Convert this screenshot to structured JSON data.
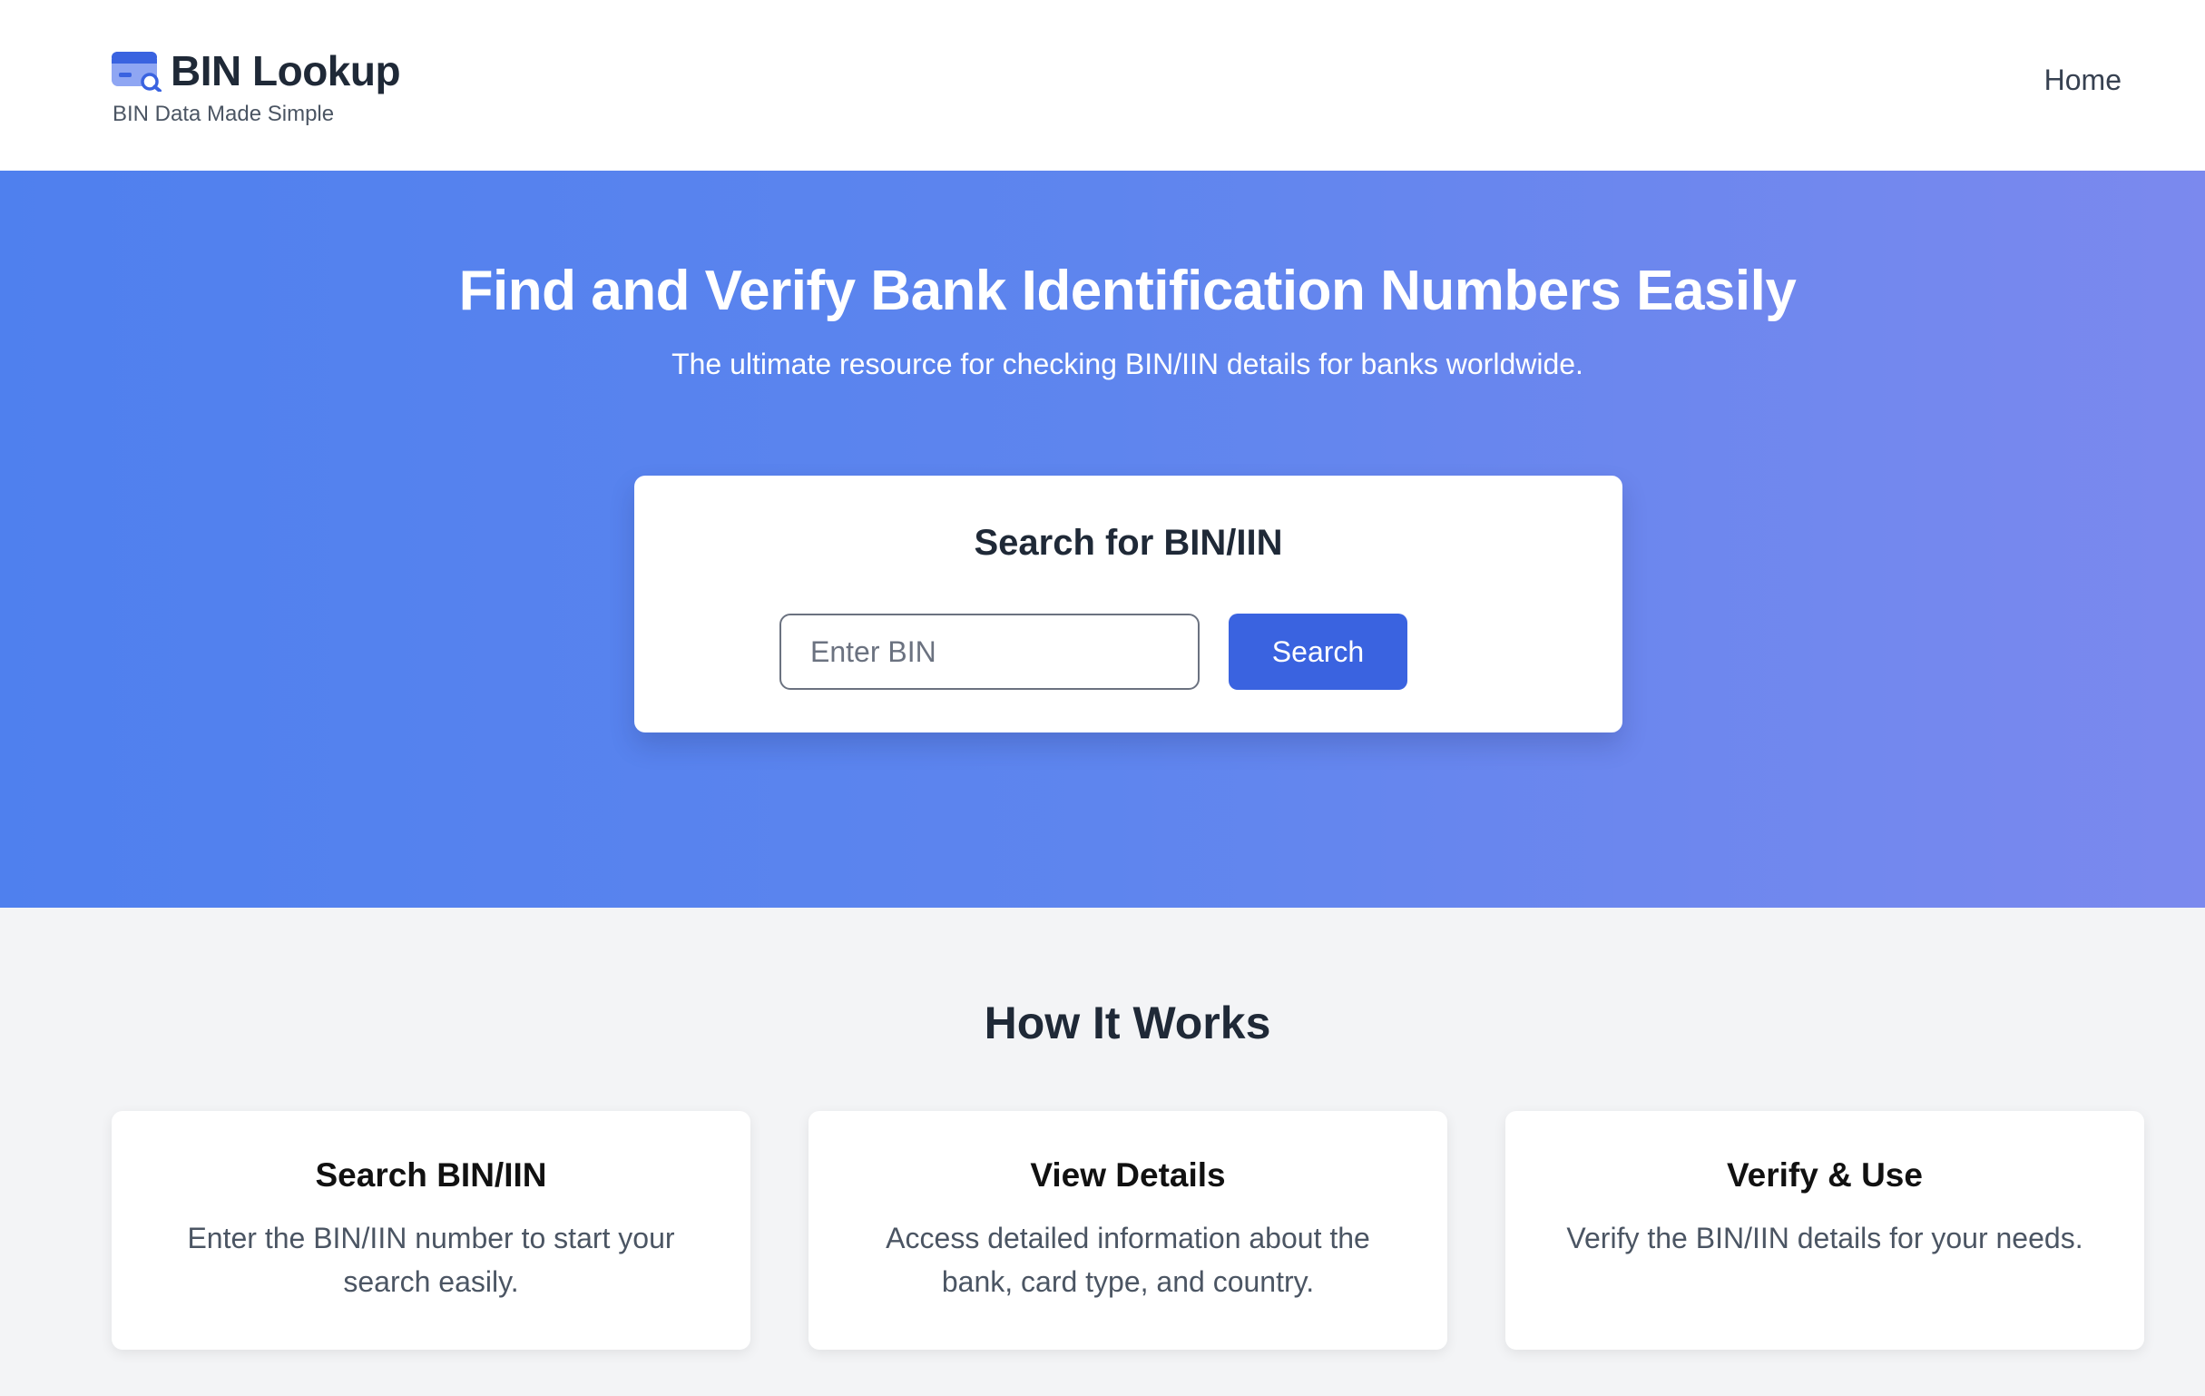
{
  "header": {
    "brand_name": "BIN Lookup",
    "tagline": "BIN Data Made Simple",
    "logo_icon": "credit-card-search-icon",
    "nav": {
      "home_label": "Home"
    }
  },
  "hero": {
    "title": "Find and Verify Bank Identification Numbers Easily",
    "subtitle": "The ultimate resource for checking BIN/IIN details for banks worldwide.",
    "search": {
      "title": "Search for BIN/IIN",
      "input_value": "",
      "placeholder": "Enter BIN",
      "button_label": "Search"
    }
  },
  "how_it_works": {
    "title": "How It Works",
    "cards": [
      {
        "title": "Search BIN/IIN",
        "description": "Enter the BIN/IIN number to start your search easily."
      },
      {
        "title": "View Details",
        "description": "Access detailed information about the bank, card type, and country."
      },
      {
        "title": "Verify & Use",
        "description": "Verify the BIN/IIN details for your needs."
      }
    ]
  },
  "colors": {
    "hero_gradient_start": "#4f80ee",
    "hero_gradient_end": "#7b89ee",
    "primary_button": "#3a63e0",
    "page_background": "#f3f4f6"
  }
}
